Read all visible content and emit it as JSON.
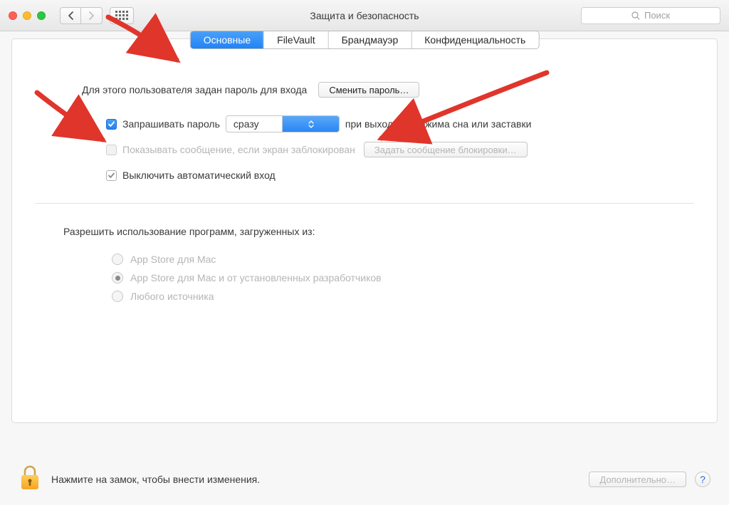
{
  "window": {
    "title": "Защита и безопасность"
  },
  "search": {
    "placeholder": "Поиск"
  },
  "tabs": {
    "general": "Основные",
    "filevault": "FileVault",
    "firewall": "Брандмауэр",
    "privacy": "Конфиденциальность"
  },
  "main": {
    "password_set_text": "Для этого пользователя задан пароль для входа",
    "change_password_btn": "Сменить пароль…",
    "require_password_label": "Запрашивать пароль",
    "require_password_after": "сразу",
    "after_sleep_text": "при выходе из режима сна или заставки",
    "show_message_label": "Показывать сообщение, если экран заблокирован",
    "set_lock_message_btn": "Задать сообщение блокировки…",
    "disable_autologin_label": "Выключить автоматический вход",
    "allow_apps_heading": "Разрешить использование программ, загруженных из:",
    "radio_appstore": "App Store для Mac",
    "radio_appstore_dev": "App Store для Mac и от установленных разработчиков",
    "radio_anywhere": "Любого источника"
  },
  "footer": {
    "lock_hint": "Нажмите на замок, чтобы внести изменения.",
    "advanced_btn": "Дополнительно…"
  }
}
